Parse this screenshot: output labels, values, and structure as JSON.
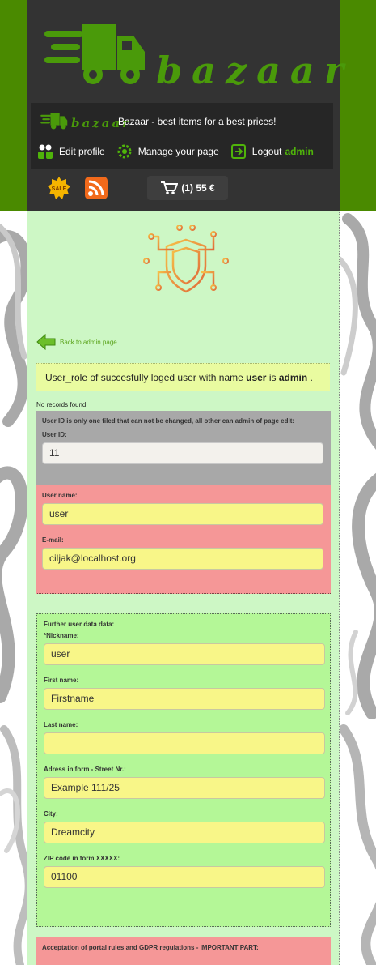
{
  "header": {
    "logo_text": "bazaar",
    "slogan": "Bazaar - best items for a best prices!",
    "nav": {
      "edit_profile": "Edit profile",
      "manage_page": "Manage your page",
      "logout": "Logout",
      "logout_user": "admin"
    },
    "cart_label": "(1) 55 €",
    "colors": {
      "brand": "#4a8a00",
      "header_bg": "#333333",
      "accent": "#4fb30a"
    }
  },
  "main": {
    "back_link": "Back to admin page.",
    "info": {
      "prefix": "User_role of succesfully loged user with name",
      "user": "user",
      "mid": "is",
      "role": "admin",
      "suffix": "."
    },
    "no_records": "No records found.",
    "id_panel": {
      "note": "User ID is only one filed that can not be changed, all other can admin of page edit:",
      "id_label": "User ID:",
      "id_value": "11"
    },
    "account_panel": {
      "username_label": "User name:",
      "username_value": "user",
      "email_label": "E-mail:",
      "email_value": "ciljak@localhost.org"
    },
    "further_panel": {
      "heading": "Further user data data:",
      "nickname_label": "*Nickname:",
      "nickname_value": "user",
      "firstname_label": "First name:",
      "firstname_value": "Firstname",
      "lastname_label": "Last name:",
      "lastname_value": "",
      "address_label": "Adress in form - Street Nr.:",
      "address_value": "Example 111/25",
      "city_label": "City:",
      "city_value": "Dreamcity",
      "zip_label": "ZIP code in form XXXXX:",
      "zip_value": "01100"
    },
    "rules_panel": {
      "heading": "Acceptation of portal rules and GDPR regulations - IMPORTANT PART:"
    }
  }
}
